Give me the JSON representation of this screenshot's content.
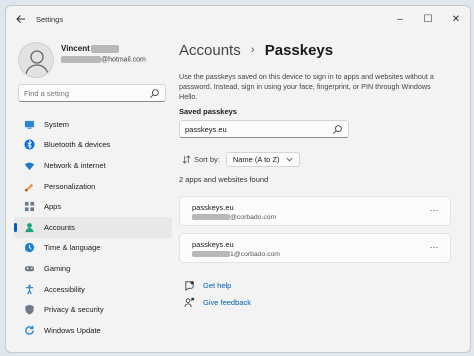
{
  "window": {
    "title": "Settings",
    "controls": [
      "–",
      "☐",
      "✕"
    ]
  },
  "user": {
    "name_visible": "Vincent",
    "email_suffix": "@hotmail.com"
  },
  "sidebar": {
    "search_placeholder": "Find a setting",
    "items": [
      {
        "label": "System",
        "icon": "system-icon"
      },
      {
        "label": "Bluetooth & devices",
        "icon": "bluetooth-icon"
      },
      {
        "label": "Network & internet",
        "icon": "network-icon"
      },
      {
        "label": "Personalization",
        "icon": "personalization-icon"
      },
      {
        "label": "Apps",
        "icon": "apps-icon"
      },
      {
        "label": "Accounts",
        "icon": "accounts-icon",
        "active": true
      },
      {
        "label": "Time & language",
        "icon": "time-language-icon"
      },
      {
        "label": "Gaming",
        "icon": "gaming-icon"
      },
      {
        "label": "Accessibility",
        "icon": "accessibility-icon"
      },
      {
        "label": "Privacy & security",
        "icon": "privacy-security-icon"
      },
      {
        "label": "Windows Update",
        "icon": "windows-update-icon"
      }
    ]
  },
  "main": {
    "breadcrumb_parent": "Accounts",
    "breadcrumb_separator": "›",
    "breadcrumb_current": "Passkeys",
    "description": "Use the passkeys saved on this device to sign in to apps and websites without a password. Instead, sign in using your face, fingerprint, or PIN through Windows Hello.",
    "saved_title": "Saved passkeys",
    "search_value": "passkeys.eu",
    "sort_label": "Sort by:",
    "sort_value": "Name (A to Z)",
    "count_text": "2 apps and websites found",
    "passkeys": [
      {
        "site": "passkeys.eu",
        "user_suffix": "@corbado.com",
        "more": "···"
      },
      {
        "site": "passkeys.eu",
        "user_suffix": "1@corbado.com",
        "more": "···"
      }
    ],
    "help_link": "Get help",
    "feedback_link": "Give feedback"
  },
  "colors": {
    "accent": "#005fb8",
    "window_bg": "#f3f3f3",
    "card_bg": "#fbfbfb"
  }
}
